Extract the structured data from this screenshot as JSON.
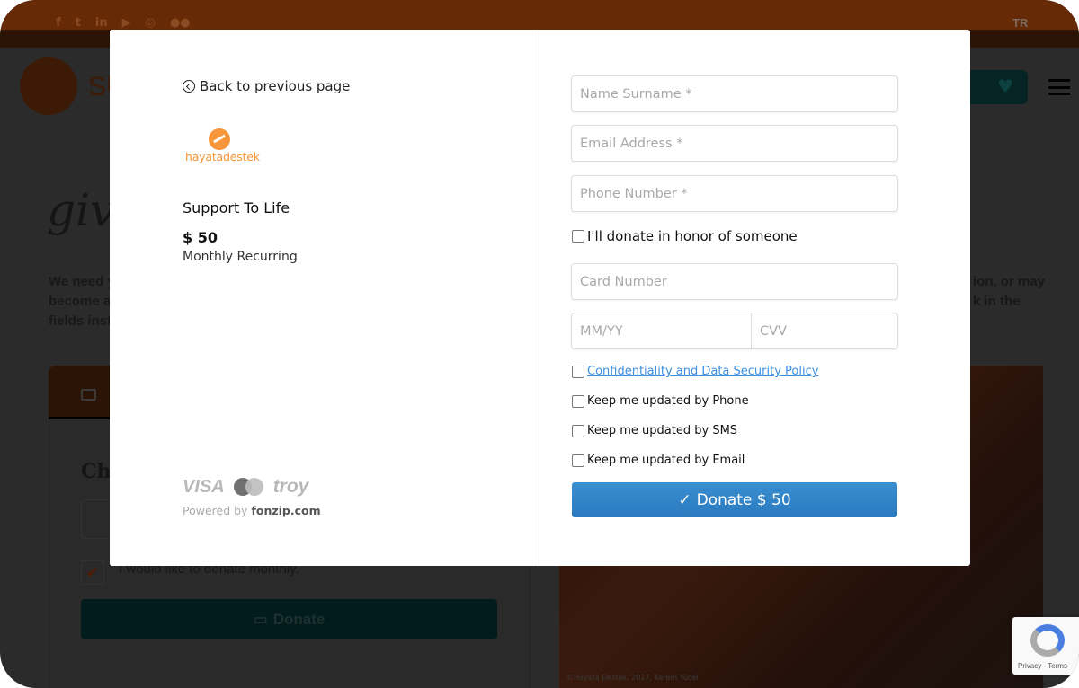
{
  "background": {
    "social_icons": [
      "facebook-icon",
      "twitter-icon",
      "linkedin-icon",
      "youtube-icon",
      "instagram-icon",
      "flickr-icon"
    ],
    "social_glyphs": [
      "f",
      "t",
      "in",
      "▶",
      "◎",
      "●●"
    ],
    "language": "TR",
    "logo_text": "SU",
    "script_text": "giv",
    "intro_left": [
      "We need y",
      "become a",
      "fields inst"
    ],
    "intro_right": [
      "ion, or may",
      "k in the"
    ],
    "card_heading": "Ch",
    "monthly_checkbox_label": "I would like to donate monthly.",
    "donate_button": "Donate",
    "photo_caption": "©Hayata Destek, 2017, Kerem Yücel",
    "recaptcha_links": "Privacy - Terms"
  },
  "modal": {
    "back_label": "Back to previous page",
    "org_logo_text": "hayatadestek",
    "org_name": "Support To Life",
    "amount": "$ 50",
    "frequency": "Monthly Recurring",
    "brands": {
      "visa": "VISA",
      "troy": "troy"
    },
    "powered_by": "Powered by",
    "powered_by_brand": "fonzip.com",
    "form": {
      "name_placeholder": "Name Surname *",
      "email_placeholder": "Email Address *",
      "phone_placeholder": "Phone Number *",
      "honor_label": "I'll donate in honor of someone",
      "card_placeholder": "Card Number",
      "expiry_placeholder": "MM/YY",
      "cvv_placeholder": "CVV",
      "policy_link": "Confidentiality and Data Security Policy",
      "updates_phone": "Keep me updated by Phone",
      "updates_sms": "Keep me updated by SMS",
      "updates_email": "Keep me updated by Email",
      "submit_label": "Donate $ 50",
      "submit_icon": "✓"
    }
  },
  "colors": {
    "accent_blue": "#2a7abf",
    "brand_orange": "#f7963a",
    "link": "#3d8fe0"
  }
}
